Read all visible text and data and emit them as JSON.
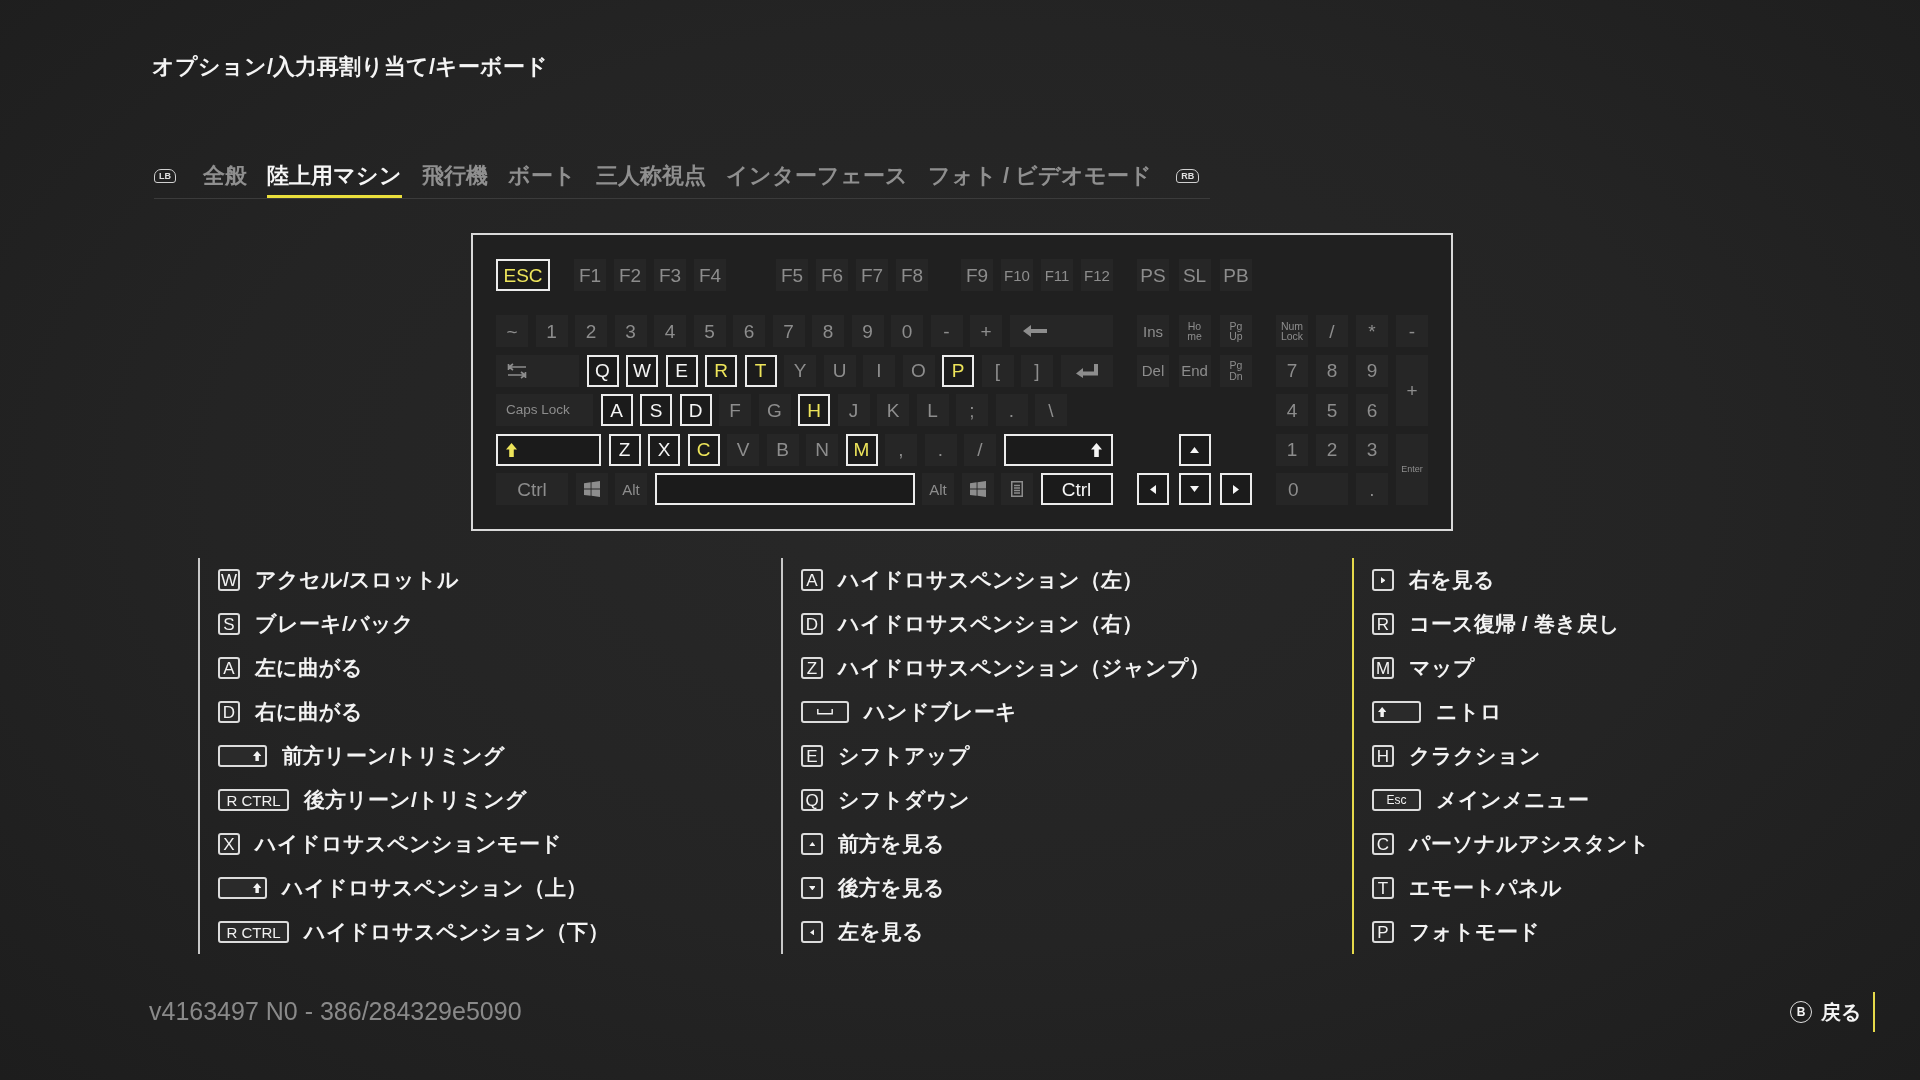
{
  "breadcrumb": "オプション/入力再割り当て/キーボード",
  "tabs": {
    "prev_hint": "LB",
    "items": [
      {
        "label": "全般",
        "selected": false
      },
      {
        "label": "陸上用マシン",
        "selected": true
      },
      {
        "label": "飛行機",
        "selected": false
      },
      {
        "label": "ボート",
        "selected": false
      },
      {
        "label": "三人称視点",
        "selected": false
      },
      {
        "label": "インターフェース",
        "selected": false
      },
      {
        "label": "フォト / ビデオモード",
        "selected": false
      }
    ],
    "next_hint": "RB"
  },
  "keyboard": {
    "function_groups": [
      [
        {
          "kind": "esc",
          "label": "ESC",
          "bound": true,
          "accent": true
        }
      ],
      [
        {
          "kind": "char",
          "label": "F1",
          "bound": false,
          "accent": false
        },
        {
          "kind": "char",
          "label": "F2",
          "bound": false,
          "accent": false
        },
        {
          "kind": "char",
          "label": "F3",
          "bound": false,
          "accent": false
        },
        {
          "kind": "char",
          "label": "F4",
          "bound": false,
          "accent": false
        }
      ],
      [
        {
          "kind": "char",
          "label": "F5",
          "bound": false,
          "accent": false
        },
        {
          "kind": "char",
          "label": "F6",
          "bound": false,
          "accent": false
        },
        {
          "kind": "char",
          "label": "F7",
          "bound": false,
          "accent": false
        },
        {
          "kind": "char",
          "label": "F8",
          "bound": false,
          "accent": false
        }
      ],
      [
        {
          "kind": "char",
          "label": "F9",
          "bound": false,
          "accent": false
        },
        {
          "kind": "char",
          "label": "F10",
          "bound": false,
          "accent": false
        },
        {
          "kind": "char",
          "label": "F11",
          "bound": false,
          "accent": false
        },
        {
          "kind": "char",
          "label": "F12",
          "bound": false,
          "accent": false
        }
      ]
    ],
    "main_rows": [
      [
        {
          "kind": "char",
          "label": "~",
          "bound": false,
          "accent": false
        },
        {
          "kind": "char",
          "label": "1",
          "bound": false,
          "accent": false
        },
        {
          "kind": "char",
          "label": "2",
          "bound": false,
          "accent": false
        },
        {
          "kind": "char",
          "label": "3",
          "bound": false,
          "accent": false
        },
        {
          "kind": "char",
          "label": "4",
          "bound": false,
          "accent": false
        },
        {
          "kind": "char",
          "label": "5",
          "bound": false,
          "accent": false
        },
        {
          "kind": "char",
          "label": "6",
          "bound": false,
          "accent": false
        },
        {
          "kind": "char",
          "label": "7",
          "bound": false,
          "accent": false
        },
        {
          "kind": "char",
          "label": "8",
          "bound": false,
          "accent": false
        },
        {
          "kind": "char",
          "label": "9",
          "bound": false,
          "accent": false
        },
        {
          "kind": "char",
          "label": "0",
          "bound": false,
          "accent": false
        },
        {
          "kind": "char",
          "label": "-",
          "bound": false,
          "accent": false
        },
        {
          "kind": "char",
          "label": "+",
          "bound": false,
          "accent": false
        },
        {
          "kind": "backspace",
          "bound": false,
          "accent": false
        }
      ],
      [
        {
          "kind": "tab",
          "bound": false,
          "accent": false
        },
        {
          "kind": "char",
          "label": "Q",
          "bound": true,
          "accent": false
        },
        {
          "kind": "char",
          "label": "W",
          "bound": true,
          "accent": false
        },
        {
          "kind": "char",
          "label": "E",
          "bound": true,
          "accent": false
        },
        {
          "kind": "char",
          "label": "R",
          "bound": true,
          "accent": true
        },
        {
          "kind": "char",
          "label": "T",
          "bound": true,
          "accent": true
        },
        {
          "kind": "char",
          "label": "Y",
          "bound": false,
          "accent": false
        },
        {
          "kind": "char",
          "label": "U",
          "bound": false,
          "accent": false
        },
        {
          "kind": "char",
          "label": "I",
          "bound": false,
          "accent": false
        },
        {
          "kind": "char",
          "label": "O",
          "bound": false,
          "accent": false
        },
        {
          "kind": "char",
          "label": "P",
          "bound": true,
          "accent": true
        },
        {
          "kind": "char",
          "label": "[",
          "bound": false,
          "accent": false
        },
        {
          "kind": "char",
          "label": "]",
          "bound": false,
          "accent": false
        },
        {
          "kind": "enter",
          "bound": false,
          "accent": false
        }
      ],
      [
        {
          "kind": "caps",
          "label": "Caps Lock",
          "bound": false,
          "accent": false
        },
        {
          "kind": "char",
          "label": "A",
          "bound": true,
          "accent": false
        },
        {
          "kind": "char",
          "label": "S",
          "bound": true,
          "accent": false
        },
        {
          "kind": "char",
          "label": "D",
          "bound": true,
          "accent": false
        },
        {
          "kind": "char",
          "label": "F",
          "bound": false,
          "accent": false
        },
        {
          "kind": "char",
          "label": "G",
          "bound": false,
          "accent": false
        },
        {
          "kind": "char",
          "label": "H",
          "bound": true,
          "accent": true
        },
        {
          "kind": "char",
          "label": "J",
          "bound": false,
          "accent": false
        },
        {
          "kind": "char",
          "label": "K",
          "bound": false,
          "accent": false
        },
        {
          "kind": "char",
          "label": "L",
          "bound": false,
          "accent": false
        },
        {
          "kind": "char",
          "label": ";",
          "bound": false,
          "accent": false
        },
        {
          "kind": "char",
          "label": ".",
          "bound": false,
          "accent": false
        },
        {
          "kind": "char",
          "label": "\\",
          "bound": false,
          "accent": false
        }
      ],
      [
        {
          "kind": "lshift",
          "bound": true,
          "accent": true
        },
        {
          "kind": "char",
          "label": "Z",
          "bound": true,
          "accent": false
        },
        {
          "kind": "char",
          "label": "X",
          "bound": true,
          "accent": false
        },
        {
          "kind": "char",
          "label": "C",
          "bound": true,
          "accent": true
        },
        {
          "kind": "char",
          "label": "V",
          "bound": false,
          "accent": false
        },
        {
          "kind": "char",
          "label": "B",
          "bound": false,
          "accent": false
        },
        {
          "kind": "char",
          "label": "N",
          "bound": false,
          "accent": false
        },
        {
          "kind": "char",
          "label": "M",
          "bound": true,
          "accent": true
        },
        {
          "kind": "char",
          "label": ",",
          "bound": false,
          "accent": false
        },
        {
          "kind": "char",
          "label": ".",
          "bound": false,
          "accent": false
        },
        {
          "kind": "char",
          "label": "/",
          "bound": false,
          "accent": false
        },
        {
          "kind": "rshift",
          "bound": true,
          "accent": false
        }
      ],
      [
        {
          "kind": "ctrl",
          "label": "Ctrl",
          "bound": false,
          "accent": false
        },
        {
          "kind": "win",
          "bound": false,
          "accent": false
        },
        {
          "kind": "alt",
          "label": "Alt",
          "bound": false,
          "accent": false
        },
        {
          "kind": "space",
          "bound": true,
          "accent": false
        },
        {
          "kind": "alt",
          "label": "Alt",
          "bound": false,
          "accent": false
        },
        {
          "kind": "win",
          "bound": false,
          "accent": false
        },
        {
          "kind": "menu",
          "bound": false,
          "accent": false
        },
        {
          "kind": "ctrl",
          "label": "Ctrl",
          "bound": true,
          "accent": false
        }
      ]
    ],
    "nav_rows": [
      [
        {
          "kind": "char",
          "label": "PS",
          "bound": false,
          "accent": false
        },
        {
          "kind": "char",
          "label": "SL",
          "bound": false,
          "accent": false
        },
        {
          "kind": "char",
          "label": "PB",
          "bound": false,
          "accent": false
        }
      ],
      [
        {
          "kind": "char",
          "label": "Ins",
          "bound": false,
          "accent": false
        },
        {
          "kind": "char",
          "label": "Ho\nme",
          "bound": false,
          "accent": false
        },
        {
          "kind": "char",
          "label": "Pg\nUp",
          "bound": false,
          "accent": false
        }
      ],
      [
        {
          "kind": "char",
          "label": "Del",
          "bound": false,
          "accent": false
        },
        {
          "kind": "char",
          "label": "End",
          "bound": false,
          "accent": false
        },
        {
          "kind": "char",
          "label": "Pg\nDn",
          "bound": false,
          "accent": false
        }
      ],
      [
        {
          "kind": "up",
          "bound": true,
          "accent": false
        }
      ],
      [
        {
          "kind": "left",
          "bound": true,
          "accent": false
        },
        {
          "kind": "down",
          "bound": true,
          "accent": false
        },
        {
          "kind": "right",
          "bound": true,
          "accent": false
        }
      ]
    ],
    "numpad": [
      {
        "kind": "char",
        "label": "Num\nLock",
        "bound": false,
        "accent": false
      },
      {
        "kind": "char",
        "label": "/",
        "bound": false,
        "accent": false
      },
      {
        "kind": "char",
        "label": "*",
        "bound": false,
        "accent": false
      },
      {
        "kind": "char",
        "label": "-",
        "bound": false,
        "accent": false
      },
      {
        "kind": "char",
        "label": "7",
        "bound": false,
        "accent": false
      },
      {
        "kind": "char",
        "label": "8",
        "bound": false,
        "accent": false
      },
      {
        "kind": "char",
        "label": "9",
        "bound": false,
        "accent": false
      },
      {
        "kind": "tall",
        "label": "+",
        "bound": false,
        "accent": false
      },
      {
        "kind": "char",
        "label": "4",
        "bound": false,
        "accent": false
      },
      {
        "kind": "char",
        "label": "5",
        "bound": false,
        "accent": false
      },
      {
        "kind": "char",
        "label": "6",
        "bound": false,
        "accent": false
      },
      {
        "kind": "char",
        "label": "1",
        "bound": false,
        "accent": false
      },
      {
        "kind": "char",
        "label": "2",
        "bound": false,
        "accent": false
      },
      {
        "kind": "char",
        "label": "3",
        "bound": false,
        "accent": false
      },
      {
        "kind": "tall",
        "label": "Enter",
        "bound": false,
        "accent": false
      },
      {
        "kind": "wide",
        "label": "0",
        "bound": false,
        "accent": false
      },
      {
        "kind": "char",
        "label": ".",
        "bound": false,
        "accent": false
      }
    ]
  },
  "bindings": [
    {
      "accent": false,
      "items": [
        {
          "kind": "letter",
          "key": "W",
          "action": "アクセル/スロットル"
        },
        {
          "kind": "letter",
          "key": "S",
          "action": "ブレーキ/バック"
        },
        {
          "kind": "letter",
          "key": "A",
          "action": "左に曲がる"
        },
        {
          "kind": "letter",
          "key": "D",
          "action": "右に曲がる"
        },
        {
          "kind": "rshift",
          "action": "前方リーン/トリミング"
        },
        {
          "kind": "wide",
          "key": "R CTRL",
          "action": "後方リーン/トリミング"
        },
        {
          "kind": "letter",
          "key": "X",
          "action": "ハイドロサスペンションモード"
        },
        {
          "kind": "rshift",
          "action": "ハイドロサスペンション（上）"
        },
        {
          "kind": "wide",
          "key": "R CTRL",
          "action": "ハイドロサスペンション（下）"
        }
      ]
    },
    {
      "accent": false,
      "items": [
        {
          "kind": "letter",
          "key": "A",
          "action": "ハイドロサスペンション（左）"
        },
        {
          "kind": "letter",
          "key": "D",
          "action": "ハイドロサスペンション（右）"
        },
        {
          "kind": "letter",
          "key": "Z",
          "action": "ハイドロサスペンション（ジャンプ）"
        },
        {
          "kind": "space",
          "action": "ハンドブレーキ"
        },
        {
          "kind": "letter",
          "key": "E",
          "action": "シフトアップ"
        },
        {
          "kind": "letter",
          "key": "Q",
          "action": "シフトダウン"
        },
        {
          "kind": "up",
          "action": "前方を見る"
        },
        {
          "kind": "down",
          "action": "後方を見る"
        },
        {
          "kind": "left",
          "action": "左を見る"
        }
      ]
    },
    {
      "accent": true,
      "items": [
        {
          "kind": "right",
          "action": "右を見る"
        },
        {
          "kind": "letter",
          "key": "R",
          "action": "コース復帰 / 巻き戻し"
        },
        {
          "kind": "letter",
          "key": "M",
          "action": "マップ"
        },
        {
          "kind": "lshift",
          "action": "ニトロ"
        },
        {
          "kind": "letter",
          "key": "H",
          "action": "クラクション"
        },
        {
          "kind": "wide",
          "key": "Esc",
          "action": "メインメニュー"
        },
        {
          "kind": "letter",
          "key": "C",
          "action": "パーソナルアシスタント"
        },
        {
          "kind": "letter",
          "key": "T",
          "action": "エモートパネル"
        },
        {
          "kind": "letter",
          "key": "P",
          "action": "フォトモード"
        }
      ]
    }
  ],
  "footer": {
    "version": "v4163497 N0 - 386/284329e5090",
    "back": {
      "hint": "B",
      "label": "戻る"
    }
  }
}
